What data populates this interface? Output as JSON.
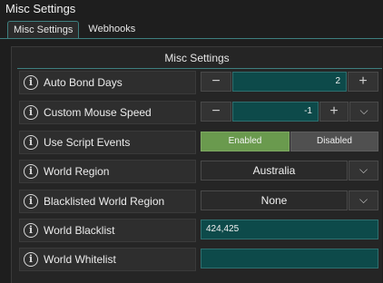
{
  "window": {
    "title": "Misc Settings"
  },
  "tabs": [
    {
      "label": "Misc Settings",
      "active": true
    },
    {
      "label": "Webhooks",
      "active": false
    }
  ],
  "panel": {
    "title": "Misc Settings"
  },
  "settings": {
    "auto_bond_days": {
      "label": "Auto Bond Days",
      "value": "2",
      "minus": "−",
      "plus": "+"
    },
    "custom_mouse_speed": {
      "label": "Custom Mouse Speed",
      "value": "-1",
      "minus": "−",
      "plus": "+",
      "dropdown": "⌵"
    },
    "use_script_events": {
      "label": "Use Script Events",
      "on_label": "Enabled",
      "off_label": "Disabled",
      "selected": "Enabled"
    },
    "world_region": {
      "label": "World Region",
      "value": "Australia",
      "dropdown": "⌵"
    },
    "blacklisted_world_region": {
      "label": "Blacklisted World Region",
      "value": "None",
      "dropdown": "⌵"
    },
    "world_blacklist": {
      "label": "World Blacklist",
      "value": "424,425"
    },
    "world_whitelist": {
      "label": "World Whitelist",
      "value": ""
    }
  },
  "info_glyph": "i",
  "colors": {
    "accent": "#3e7f7f",
    "teal_field": "#0d4a4a",
    "enabled_green": "#6a9a4e"
  }
}
